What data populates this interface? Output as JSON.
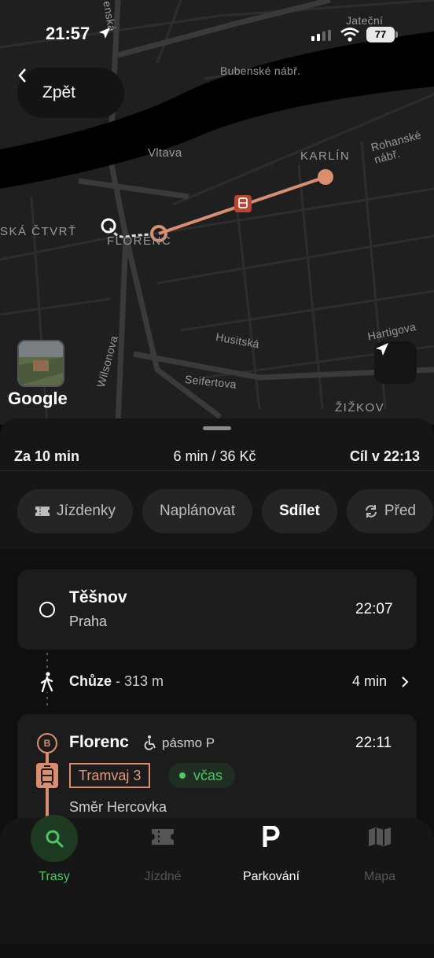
{
  "status_bar": {
    "time": "21:57",
    "battery": "77"
  },
  "map": {
    "labels": {
      "jatecni": "Jateční",
      "bubenske": "Bubenské nábř.",
      "rohanske": "Rohanské nábř.",
      "vltava": "Vltava",
      "karlin": "KARLÍN",
      "ska_ctvrt": "SKÁ ČTVRŤ",
      "florenc": "FLORENC",
      "hartigova": "Hartigova",
      "husitska": "Husitská",
      "seifertova": "Seifertova",
      "wilsonova": "Wilsonova",
      "zizkov": "ŽIŽKOV",
      "enska": "enská"
    },
    "google": "Google",
    "route_color": "#d98e72"
  },
  "back_button": {
    "label": "Zpět"
  },
  "summary": {
    "depart": "Za 10 min",
    "duration_price": "6 min / 36 Kč",
    "arrive": "Cíl v 22:13"
  },
  "actions": [
    {
      "label": "Jízdenky",
      "icon": "ticket-icon"
    },
    {
      "label": "Naplánovat"
    },
    {
      "label": "Sdílet"
    },
    {
      "label": "Před",
      "icon": "refresh-icon"
    }
  ],
  "stop1": {
    "name": "Těšnov",
    "city": "Praha",
    "time": "22:07"
  },
  "walk": {
    "label": "Chůze",
    "distance": " - 313 m",
    "duration": "4 min"
  },
  "stop2": {
    "name": "Florenc",
    "zone": "pásmo P",
    "time": "22:11",
    "platform": "B",
    "line": "Tramvaj 3",
    "status": "včas",
    "direction": "Směr Hercovka"
  },
  "bottom_nav": [
    {
      "label": "Trasy",
      "icon": "search-icon",
      "color": "#4cc764"
    },
    {
      "label": "Jízdné",
      "icon": "ticket-icon"
    },
    {
      "label": "Parkování",
      "icon": "parking-icon"
    },
    {
      "label": "Mapa",
      "icon": "map-icon"
    }
  ],
  "colors": {
    "accent_green": "#4cc764",
    "tram": "#d98e72"
  }
}
